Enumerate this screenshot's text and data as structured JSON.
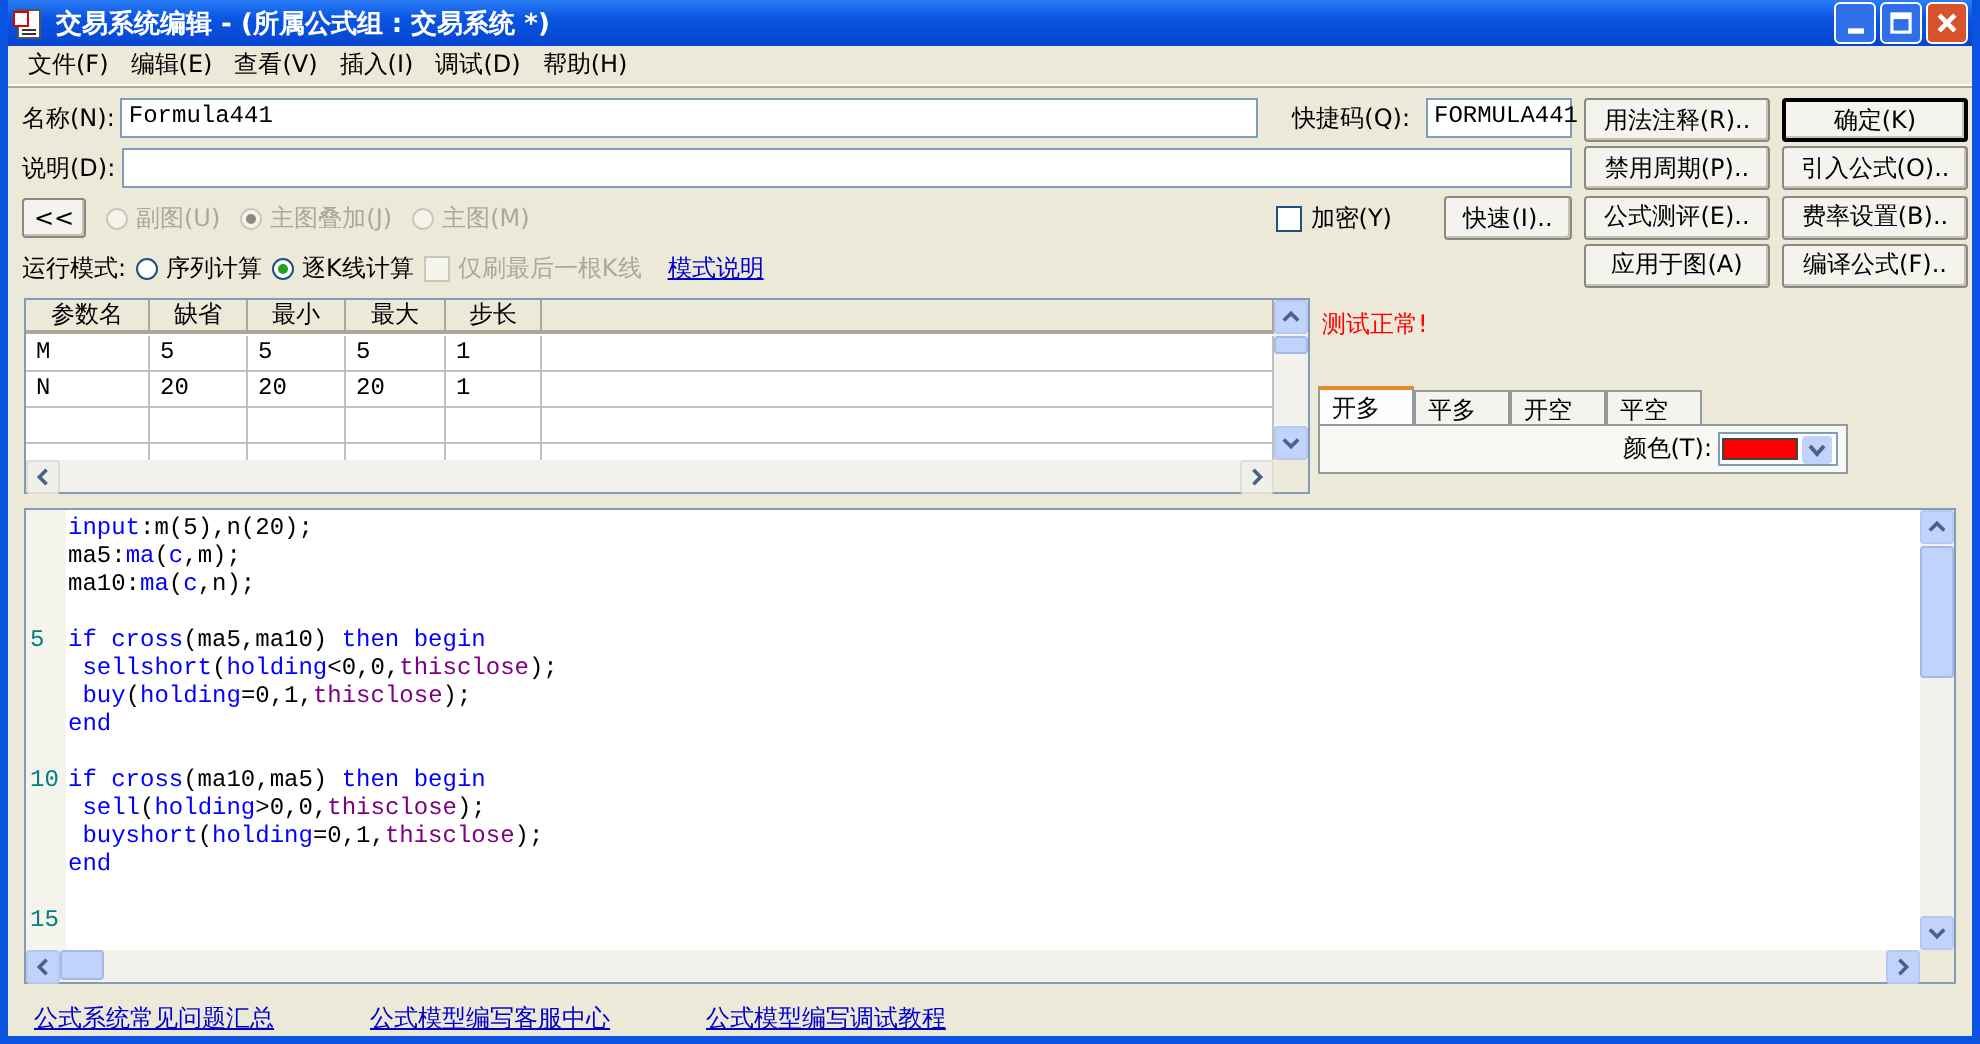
{
  "window": {
    "title": "交易系统编辑 - (所属公式组 : 交易系统 *)"
  },
  "menu": [
    {
      "label": "文件(F)"
    },
    {
      "label": "编辑(E)"
    },
    {
      "label": "查看(V)"
    },
    {
      "label": "插入(I)"
    },
    {
      "label": "调试(D)"
    },
    {
      "label": "帮助(H)"
    }
  ],
  "name_field": {
    "label": "名称(N):",
    "value": "Formula441"
  },
  "hotkey_field": {
    "label": "快捷码(Q):",
    "value": "FORMULA441"
  },
  "desc_field": {
    "label": "说明(D):"
  },
  "side_buttons": [
    {
      "label": "用法注释(R)..",
      "default": false
    },
    {
      "label": "确定(K)",
      "default": true
    },
    {
      "label": "禁用周期(P)..",
      "default": false
    },
    {
      "label": "引入公式(O)..",
      "default": false
    },
    {
      "label": "公式测评(E)..",
      "default": false
    },
    {
      "label": "费率设置(B)..",
      "default": false
    },
    {
      "label": "应用于图(A)",
      "default": false
    },
    {
      "label": "编译公式(F)..",
      "default": false
    }
  ],
  "collapse_button": {
    "label": "<<"
  },
  "chart_types": [
    {
      "label": "副图(U)",
      "selected": false,
      "disabled": true
    },
    {
      "label": "主图叠加(J)",
      "selected": true,
      "disabled": true
    },
    {
      "label": "主图(M)",
      "selected": false,
      "disabled": true
    }
  ],
  "encrypt": {
    "label": "加密(Y)",
    "checked": false
  },
  "fast_button": {
    "label": "快速(I).."
  },
  "run_mode": {
    "label": "运行模式:",
    "options": [
      {
        "label": "序列计算",
        "selected": false
      },
      {
        "label": "逐K线计算",
        "selected": true
      }
    ],
    "refresh_last": {
      "label": "仅刷最后一根K线",
      "checked": false,
      "disabled": true
    },
    "link": "模式说明"
  },
  "params": {
    "columns": [
      "参数名",
      "缺省",
      "最小",
      "最大",
      "步长"
    ],
    "rows": [
      [
        "M",
        "5",
        "5",
        "5",
        "1"
      ],
      [
        "N",
        "20",
        "20",
        "20",
        "1"
      ]
    ]
  },
  "test_status": "测试正常!",
  "signal_tabs": [
    {
      "label": "开多",
      "selected": true
    },
    {
      "label": "平多",
      "selected": false
    },
    {
      "label": "开空",
      "selected": false
    },
    {
      "label": "平空",
      "selected": false
    }
  ],
  "color_field": {
    "label": "颜色(T):",
    "color": "#ff0000"
  },
  "code": [
    {
      "kind": "code",
      "tokens": [
        {
          "text": "input",
          "kind": "keyword"
        },
        {
          "text": ":m(5),n(20);",
          "kind": "plain"
        }
      ]
    },
    {
      "kind": "code",
      "tokens": [
        {
          "text": "ma5:",
          "kind": "plain"
        },
        {
          "text": "ma",
          "kind": "keyword"
        },
        {
          "text": "(",
          "kind": "plain"
        },
        {
          "text": "c",
          "kind": "keyword"
        },
        {
          "text": ",m);",
          "kind": "plain"
        }
      ]
    },
    {
      "kind": "code",
      "tokens": [
        {
          "text": "ma10:",
          "kind": "plain"
        },
        {
          "text": "ma",
          "kind": "keyword"
        },
        {
          "text": "(",
          "kind": "plain"
        },
        {
          "text": "c",
          "kind": "keyword"
        },
        {
          "text": ",n);",
          "kind": "plain"
        }
      ]
    },
    {
      "kind": "blank"
    },
    {
      "kind": "code",
      "number": "5",
      "tokens": [
        {
          "text": "if cross",
          "kind": "keyword"
        },
        {
          "text": "(ma5,ma10) ",
          "kind": "plain"
        },
        {
          "text": "then begin",
          "kind": "keyword"
        }
      ]
    },
    {
      "kind": "code",
      "tokens": [
        {
          "text": " sellshort",
          "kind": "keyword"
        },
        {
          "text": "(",
          "kind": "plain"
        },
        {
          "text": "holding",
          "kind": "keyword"
        },
        {
          "text": "<0,0,",
          "kind": "plain"
        },
        {
          "text": "thisclose",
          "kind": "system"
        },
        {
          "text": ");",
          "kind": "plain"
        }
      ]
    },
    {
      "kind": "code",
      "tokens": [
        {
          "text": " buy",
          "kind": "keyword"
        },
        {
          "text": "(",
          "kind": "plain"
        },
        {
          "text": "holding",
          "kind": "keyword"
        },
        {
          "text": "=0,1,",
          "kind": "plain"
        },
        {
          "text": "thisclose",
          "kind": "system"
        },
        {
          "text": ");",
          "kind": "plain"
        }
      ]
    },
    {
      "kind": "code",
      "tokens": [
        {
          "text": "end",
          "kind": "keyword"
        }
      ]
    },
    {
      "kind": "blank"
    },
    {
      "kind": "code",
      "number": "10",
      "tokens": [
        {
          "text": "if cross",
          "kind": "keyword"
        },
        {
          "text": "(ma10,ma5) ",
          "kind": "plain"
        },
        {
          "text": "then begin",
          "kind": "keyword"
        }
      ]
    },
    {
      "kind": "code",
      "tokens": [
        {
          "text": " sell",
          "kind": "keyword"
        },
        {
          "text": "(",
          "kind": "plain"
        },
        {
          "text": "holding",
          "kind": "keyword"
        },
        {
          "text": ">0,0,",
          "kind": "plain"
        },
        {
          "text": "thisclose",
          "kind": "system"
        },
        {
          "text": ");",
          "kind": "plain"
        }
      ]
    },
    {
      "kind": "code",
      "tokens": [
        {
          "text": " buyshort",
          "kind": "keyword"
        },
        {
          "text": "(",
          "kind": "plain"
        },
        {
          "text": "holding",
          "kind": "keyword"
        },
        {
          "text": "=0,1,",
          "kind": "plain"
        },
        {
          "text": "thisclose",
          "kind": "system"
        },
        {
          "text": ");",
          "kind": "plain"
        }
      ]
    },
    {
      "kind": "code",
      "tokens": [
        {
          "text": "end",
          "kind": "keyword"
        }
      ]
    },
    {
      "kind": "blank"
    },
    {
      "kind": "blank",
      "number": "15"
    }
  ],
  "footer_links": [
    "公式系统常见问题汇总",
    "公式模型编写客服中心",
    "公式模型编写调试教程"
  ]
}
